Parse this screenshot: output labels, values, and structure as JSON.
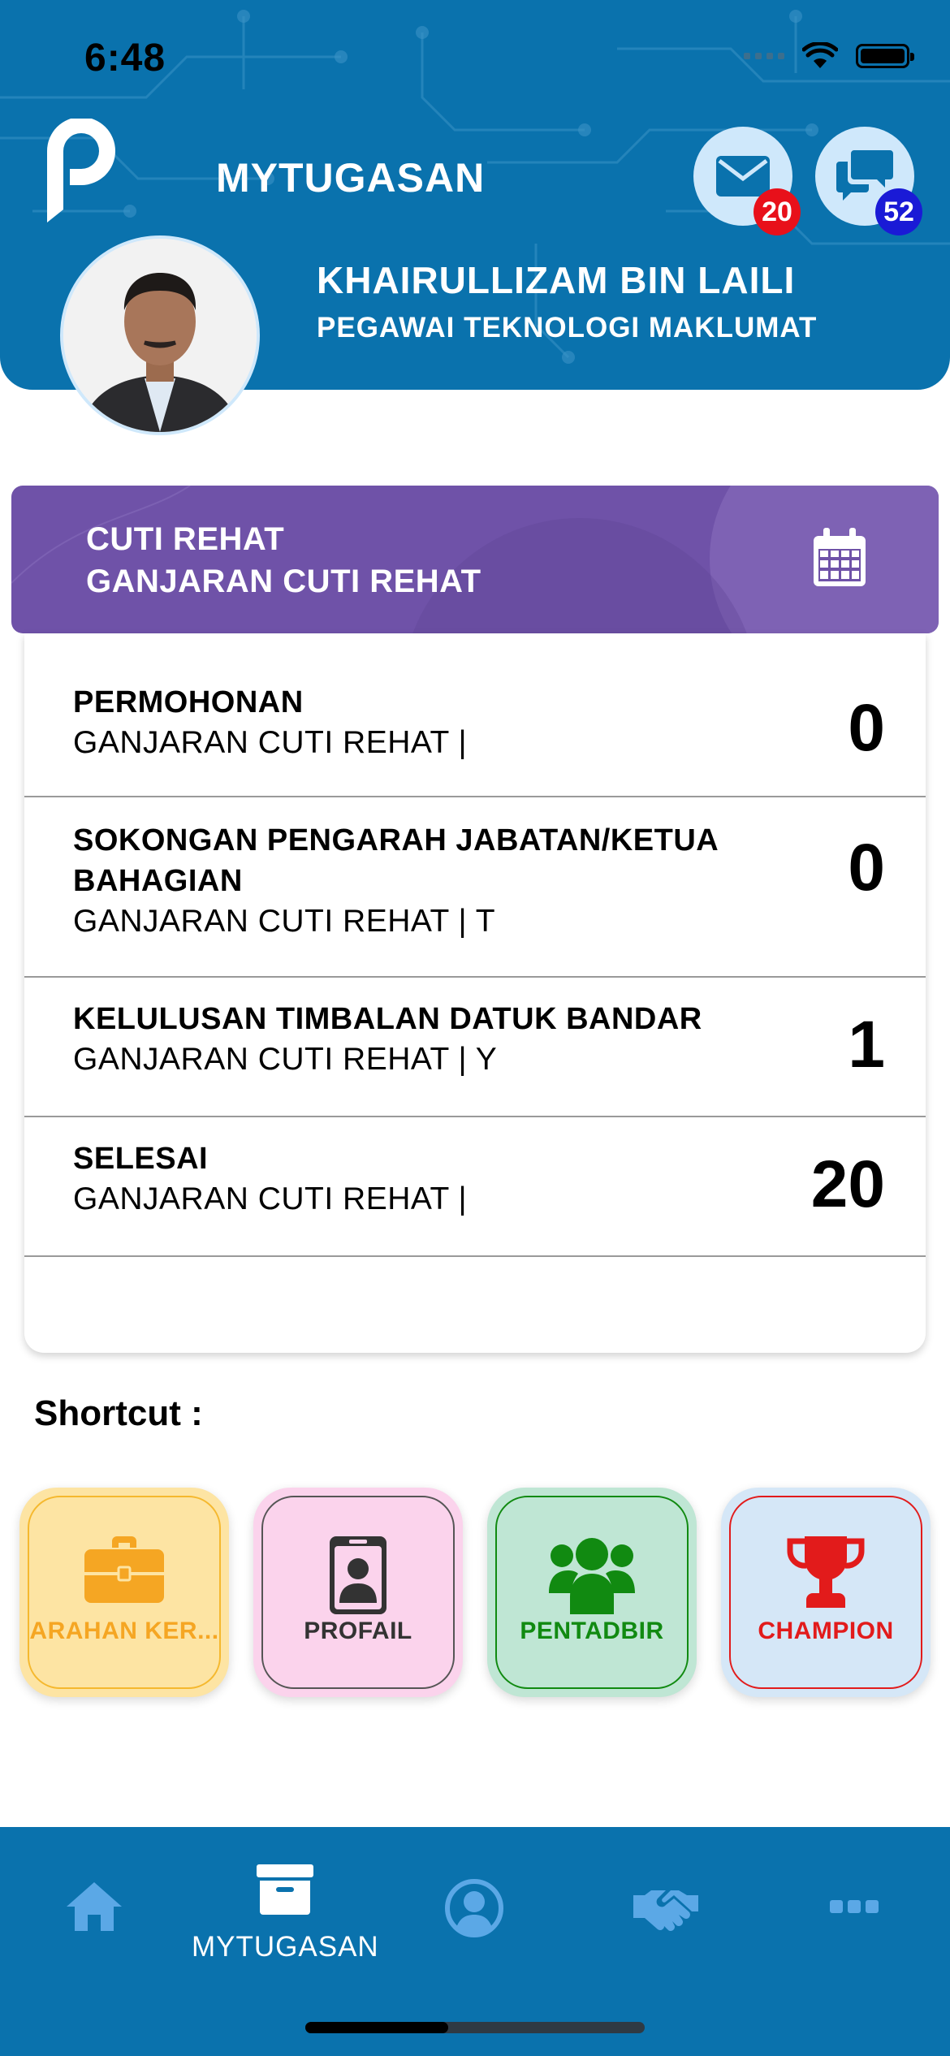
{
  "status_bar": {
    "time": "6:48"
  },
  "header": {
    "app_title": "MYTUGASAN",
    "mail_badge": "20",
    "chat_badge": "52",
    "user_name": "KHAIRULLIZAM BIN LAILI",
    "user_role": "PEGAWAI TEKNOLOGI MAKLUMAT",
    "colors": {
      "header_bg": "#0a72ad",
      "mail_badge": "#e8101a",
      "chat_badge": "#1a1ad6"
    }
  },
  "leave_card": {
    "title": "CUTI REHAT",
    "subtitle": "GANJARAN CUTI REHAT",
    "icon": "calendar-icon",
    "color": "#6f52a8"
  },
  "status_rows": [
    {
      "title": "PERMOHONAN",
      "subtitle": "GANJARAN CUTI REHAT |",
      "count": "0"
    },
    {
      "title": "SOKONGAN PENGARAH JABATAN/KETUA BAHAGIAN",
      "subtitle": "GANJARAN CUTI REHAT | T",
      "count": "0"
    },
    {
      "title": "KELULUSAN TIMBALAN DATUK BANDAR",
      "subtitle": "GANJARAN CUTI REHAT | Y",
      "count": "1"
    },
    {
      "title": "SELESAI",
      "subtitle": "GANJARAN CUTI REHAT |",
      "count": "20"
    }
  ],
  "shortcuts": {
    "label": "Shortcut :",
    "items": [
      {
        "label": "ARAHAN KER...",
        "icon": "briefcase-icon",
        "color": "#f5a623",
        "bg": "#fde4a3"
      },
      {
        "label": "PROFAIL",
        "icon": "id-badge-icon",
        "color": "#333333",
        "bg": "#fbd3ec"
      },
      {
        "label": "PENTADBIR",
        "icon": "users-icon",
        "color": "#118a11",
        "bg": "#bfe6d4"
      },
      {
        "label": "CHAMPION",
        "icon": "trophy-icon",
        "color": "#e21b1b",
        "bg": "#d5e7f7"
      }
    ]
  },
  "bottom_nav": {
    "items": [
      {
        "icon": "home-icon",
        "label": ""
      },
      {
        "icon": "archive-icon",
        "label": "MYTUGASAN"
      },
      {
        "icon": "user-circle-icon",
        "label": ""
      },
      {
        "icon": "handshake-icon",
        "label": ""
      },
      {
        "icon": "more-icon",
        "label": ""
      }
    ]
  }
}
